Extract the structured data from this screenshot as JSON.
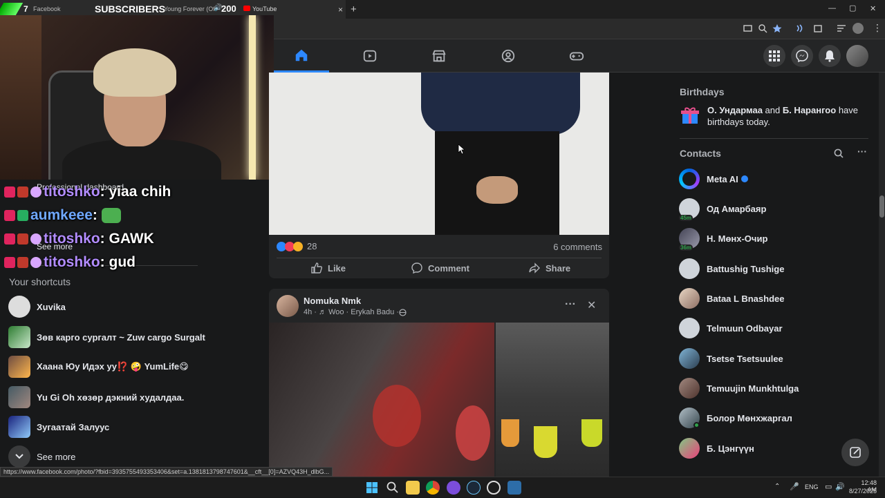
{
  "browser": {
    "tab_count": "7",
    "tab_label": "Facebook",
    "tab_close": "×",
    "new_tab": "+",
    "window_min": "—",
    "window_max": "▢",
    "window_close": "✕"
  },
  "stream_overlay": {
    "subscribers_label": "SUBSCRIBERS",
    "song": "Young Forever (Of",
    "count": "200",
    "source": "YouTube",
    "chat": [
      {
        "user": "titoshko",
        "message": "yiaa chih"
      },
      {
        "user": "aumkeee",
        "message": ""
      },
      {
        "user": "titoshko",
        "message": "GAWK"
      },
      {
        "user": "titoshko",
        "message": "gud"
      }
    ]
  },
  "left_sidebar": {
    "professional_dashboard": "Professional dashboard",
    "see_more_top": "See more",
    "shortcuts_title": "Your shortcuts",
    "shortcuts": [
      {
        "label": "Xuvika"
      },
      {
        "label": "Зөв карго сургалт ~ Zuw cargo Surgalt"
      },
      {
        "label": "Хаана Юу Идэх уу⁉️ 🤪 YumLife😋"
      },
      {
        "label": "Yu Gi Oh хөзөр дэкний худалдаа."
      },
      {
        "label": "Зугаатай Залуус"
      }
    ],
    "see_more_bottom": "See more"
  },
  "feed": {
    "post1": {
      "reaction_count": "28",
      "comments": "6 comments",
      "like": "Like",
      "comment": "Comment",
      "share": "Share"
    },
    "post2": {
      "author": "Nomuka Nmk",
      "meta": "4h · ♬ Woo · Erykah Badu · ",
      "more": "···",
      "close": "✕"
    }
  },
  "right_sidebar": {
    "birthdays_title": "Birthdays",
    "birthday_name1": "О. Ундармаа",
    "birthday_and": " and ",
    "birthday_name2": "Б. Нарангоо",
    "birthday_tail": " have birthdays today.",
    "contacts_title": "Contacts",
    "contacts": [
      {
        "name": "Meta AI",
        "badge": ""
      },
      {
        "name": "Од Амарбаяр",
        "badge": "45m"
      },
      {
        "name": "Н. Мөнх-Очир",
        "badge": "36m"
      },
      {
        "name": "Battushig Tushige",
        "badge": ""
      },
      {
        "name": "Bataa L Bnashdee",
        "badge": ""
      },
      {
        "name": "Telmuun Odbayar",
        "badge": ""
      },
      {
        "name": "Tsetse Tsetsuulee",
        "badge": ""
      },
      {
        "name": "Temuujin Munkhtulga",
        "badge": ""
      },
      {
        "name": "Болор Мөнхжаргал",
        "badge": ""
      },
      {
        "name": "Б. Цэнгүүн",
        "badge": ""
      }
    ]
  },
  "status_url": "https://www.facebook.com/photo/?fbid=393575549335340​6&set=a.1381813798747601&__cft__[0]=AZVQ43H_dlbG...",
  "taskbar": {
    "lang": "ENG",
    "time": "12:48 AM",
    "date": "8/27/2025"
  },
  "colors": {
    "fb_blue": "#2d88ff",
    "bg": "#18191a",
    "card": "#242526",
    "online": "#31a24c"
  }
}
